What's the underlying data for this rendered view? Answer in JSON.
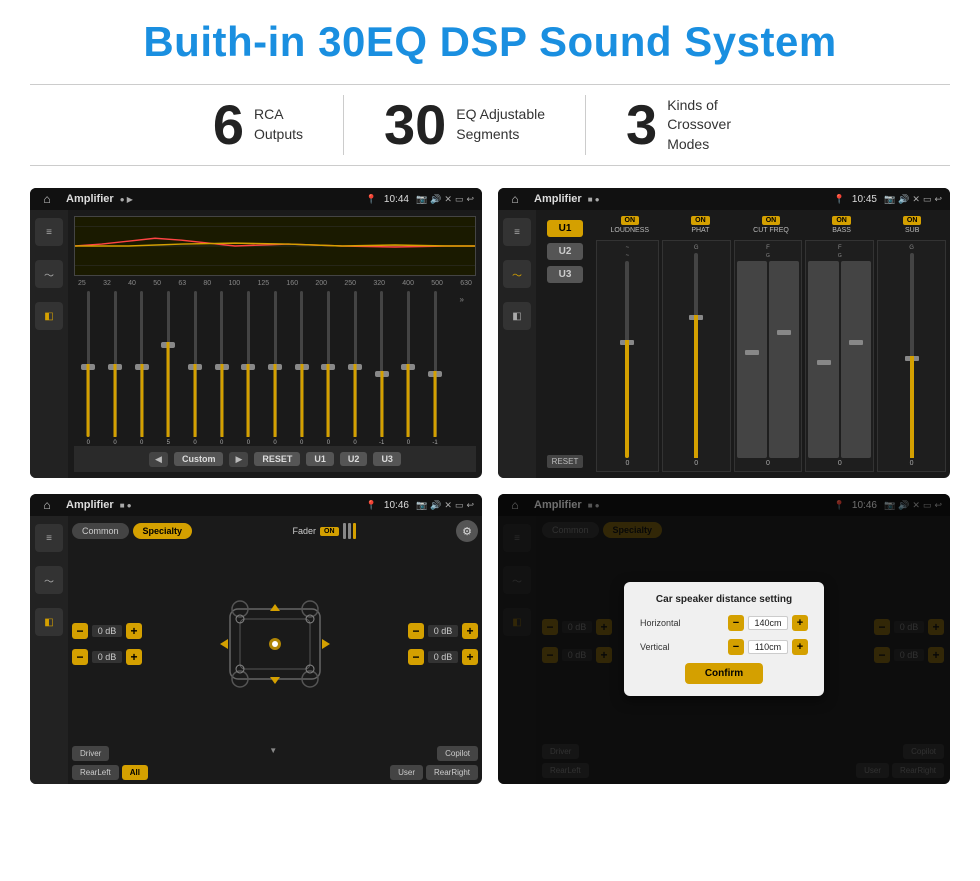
{
  "page": {
    "title": "Buith-in 30EQ DSP Sound System",
    "stats": [
      {
        "number": "6",
        "text_line1": "RCA",
        "text_line2": "Outputs"
      },
      {
        "number": "30",
        "text_line1": "EQ Adjustable",
        "text_line2": "Segments"
      },
      {
        "number": "3",
        "text_line1": "Kinds of",
        "text_line2": "Crossover Modes"
      }
    ]
  },
  "screens": {
    "screen1": {
      "title": "Amplifier",
      "time": "10:44",
      "eq_freqs": [
        "25",
        "32",
        "40",
        "50",
        "63",
        "80",
        "100",
        "125",
        "160",
        "200",
        "250",
        "320",
        "400",
        "500",
        "630"
      ],
      "eq_values": [
        "0",
        "0",
        "0",
        "5",
        "0",
        "0",
        "0",
        "0",
        "0",
        "0",
        "0",
        "-1",
        "0",
        "-1"
      ],
      "preset_label": "Custom",
      "buttons": [
        "RESET",
        "U1",
        "U2",
        "U3"
      ]
    },
    "screen2": {
      "title": "Amplifier",
      "time": "10:45",
      "units": [
        "U1",
        "U2",
        "U3"
      ],
      "channels": [
        "LOUDNESS",
        "PHAT",
        "CUT FREQ",
        "BASS",
        "SUB"
      ],
      "reset_btn": "RESET"
    },
    "screen3": {
      "title": "Amplifier",
      "time": "10:46",
      "tabs": [
        "Common",
        "Specialty"
      ],
      "active_tab": "Specialty",
      "fader_label": "Fader",
      "fader_on": "ON",
      "db_values": [
        "0 dB",
        "0 dB",
        "0 dB",
        "0 dB"
      ],
      "speaker_buttons": [
        "Driver",
        "RearLeft",
        "All",
        "User",
        "RearRight",
        "Copilot"
      ]
    },
    "screen4": {
      "title": "Amplifier",
      "time": "10:46",
      "tabs": [
        "Common",
        "Specialty"
      ],
      "modal": {
        "title": "Car speaker distance setting",
        "horizontal_label": "Horizontal",
        "horizontal_value": "140cm",
        "vertical_label": "Vertical",
        "vertical_value": "110cm",
        "confirm_btn": "Confirm"
      },
      "db_values": [
        "0 dB",
        "0 dB"
      ],
      "speaker_buttons": [
        "Driver",
        "RearLeft",
        "All",
        "User",
        "RearRight",
        "Copilot"
      ]
    }
  }
}
